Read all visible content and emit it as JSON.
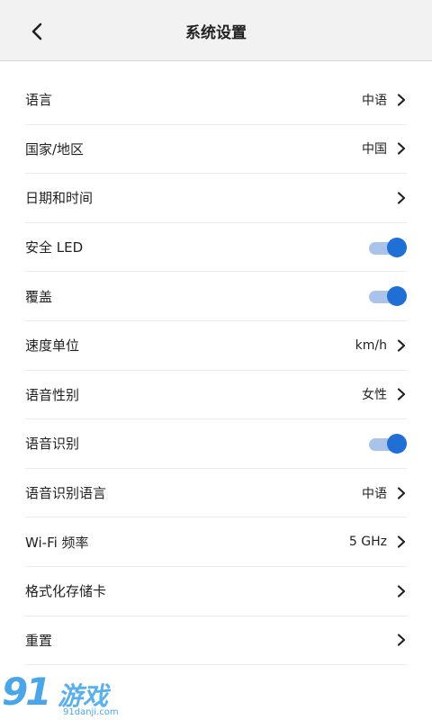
{
  "header": {
    "title": "系统设置"
  },
  "settings": [
    {
      "label": "语言",
      "value": "中语",
      "type": "nav"
    },
    {
      "label": "国家/地区",
      "value": "中国",
      "type": "nav"
    },
    {
      "label": "日期和时间",
      "value": "",
      "type": "nav"
    },
    {
      "label": "安全 LED",
      "type": "toggle",
      "on": true
    },
    {
      "label": "覆盖",
      "type": "toggle",
      "on": true
    },
    {
      "label": "速度单位",
      "value": "km/h",
      "type": "nav"
    },
    {
      "label": "语音性别",
      "value": "女性",
      "type": "nav"
    },
    {
      "label": "语音识别",
      "type": "toggle",
      "on": true
    },
    {
      "label": "语音识别语言",
      "value": "中语",
      "type": "nav"
    },
    {
      "label": "Wi-Fi 频率",
      "value": "5 GHz",
      "type": "nav"
    },
    {
      "label": "格式化存储卡",
      "value": "",
      "type": "nav"
    },
    {
      "label": "重置",
      "value": "",
      "type": "nav"
    }
  ],
  "colors": {
    "accent": "#1f6fd6",
    "track": "#a9c3ea",
    "header_bg": "#f2f2f2"
  },
  "watermark": {
    "logo": "91",
    "brand": "游戏",
    "url": "91danji.com"
  }
}
